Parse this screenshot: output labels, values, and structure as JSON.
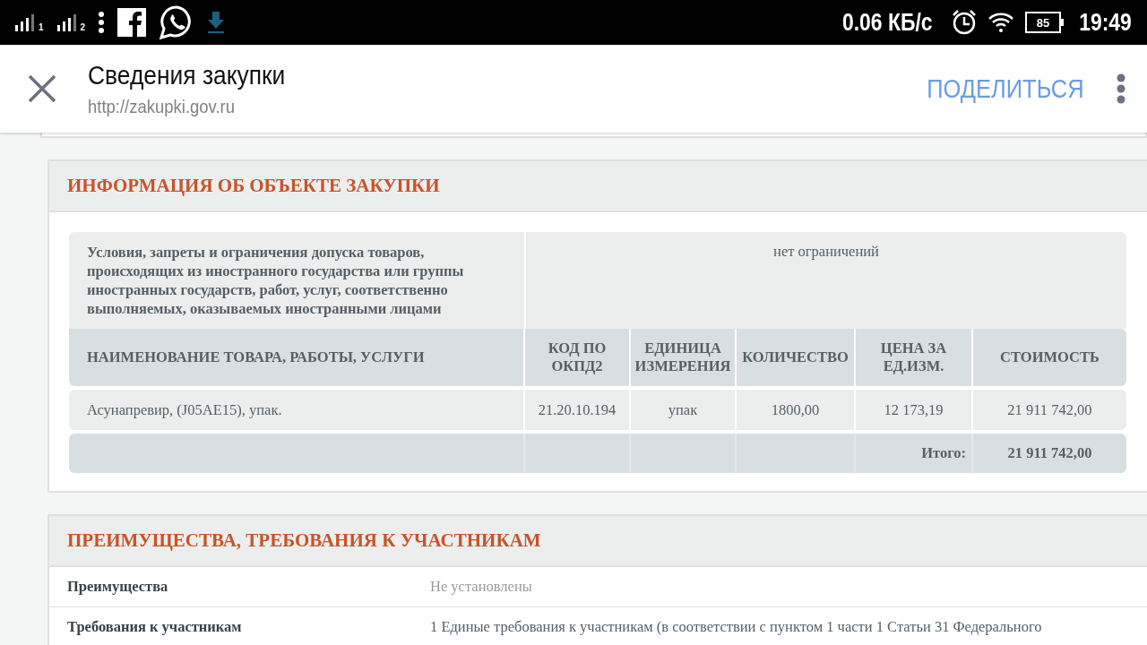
{
  "status_bar": {
    "sim_slots": [
      "1",
      "2"
    ],
    "speed": "0.06 КБ/с",
    "battery": "85",
    "time": "19:49"
  },
  "toolbar": {
    "title": "Сведения закупки",
    "url": "http://zakupki.gov.ru",
    "action": "ПОДЕЛИТЬСЯ"
  },
  "sections": [
    {
      "kind": "table",
      "title": "ИНФОРМАЦИЯ ОБ ОБЪЕКТЕ ЗАКУПКИ",
      "restriction": {
        "label": "Условия, запреты и ограничения допуска товаров, происходящих из иностранного государства или группы иностранных государств, работ, услуг, соответственно выполняемых, оказываемых иностранными лицами",
        "value": "нет ограничений"
      },
      "columns": [
        "НАИМЕНОВАНИЕ ТОВАРА, РАБОТЫ, УСЛУГИ",
        "КОД ПО ОКПД2",
        "ЕДИНИЦА ИЗМЕРЕНИЯ",
        "КОЛИЧЕСТВО",
        "ЦЕНА ЗА ЕД.ИЗМ.",
        "СТОИМОСТЬ"
      ],
      "rows": [
        [
          "Асунапревир, (J05AE15), упак.",
          "21.20.10.194",
          "упак",
          "1800,00",
          "12 173,19",
          "21 911 742,00"
        ]
      ],
      "total": {
        "label": "Итого:",
        "value": "21 911 742,00"
      }
    },
    {
      "kind": "fields",
      "title": "ПРЕИМУЩЕСТВА, ТРЕБОВАНИЯ К УЧАСТНИКАМ",
      "fields": [
        {
          "label": "Преимущества",
          "value": "Не установлены",
          "muted": true
        },
        {
          "label": "Требования к участникам",
          "value": "1 Единые требования к участникам (в соответствии с пунктом 1 части 1 Статьи 31 Федерального",
          "muted": false
        }
      ]
    }
  ]
}
